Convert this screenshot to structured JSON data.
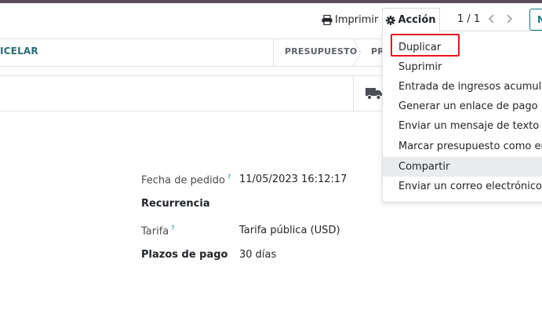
{
  "control_panel": {
    "print_label": "Imprimir",
    "action_label": "Acción",
    "pager_value": "1 / 1",
    "new_label": "N"
  },
  "status_bar": {
    "cancel_label": "ICELAR",
    "stages": [
      "PRESUPUESTO",
      "PR"
    ]
  },
  "action_menu": {
    "items": [
      "Duplicar",
      "Suprimir",
      "Entrada de ingresos acumulados",
      "Generar un enlace de pago",
      "Enviar un mensaje de texto SMS",
      "Marcar presupuesto como enviado",
      "Compartir",
      "Enviar un correo electrónico de"
    ],
    "active_item": "Compartir",
    "highlighted_item": "Duplicar"
  },
  "form": {
    "fields": [
      {
        "label": "Fecha de pedido",
        "help": "?",
        "value": "11/05/2023 16:12:17"
      },
      {
        "label": "Recurrencia",
        "value": ""
      },
      {
        "label": "Tarifa",
        "help": "?",
        "value": "Tarifa pública (USD)"
      },
      {
        "label": "Plazos de pago",
        "value": "30 días"
      }
    ]
  },
  "colors": {
    "accent": "#017e84",
    "highlight_border": "#e8141c",
    "top_bar": "#5b4a5a"
  },
  "icons": {
    "print": "printer-icon",
    "action": "gear-icon",
    "pager_prev": "chevron-left-icon",
    "pager_next": "chevron-right-icon",
    "delivery": "truck-icon"
  }
}
